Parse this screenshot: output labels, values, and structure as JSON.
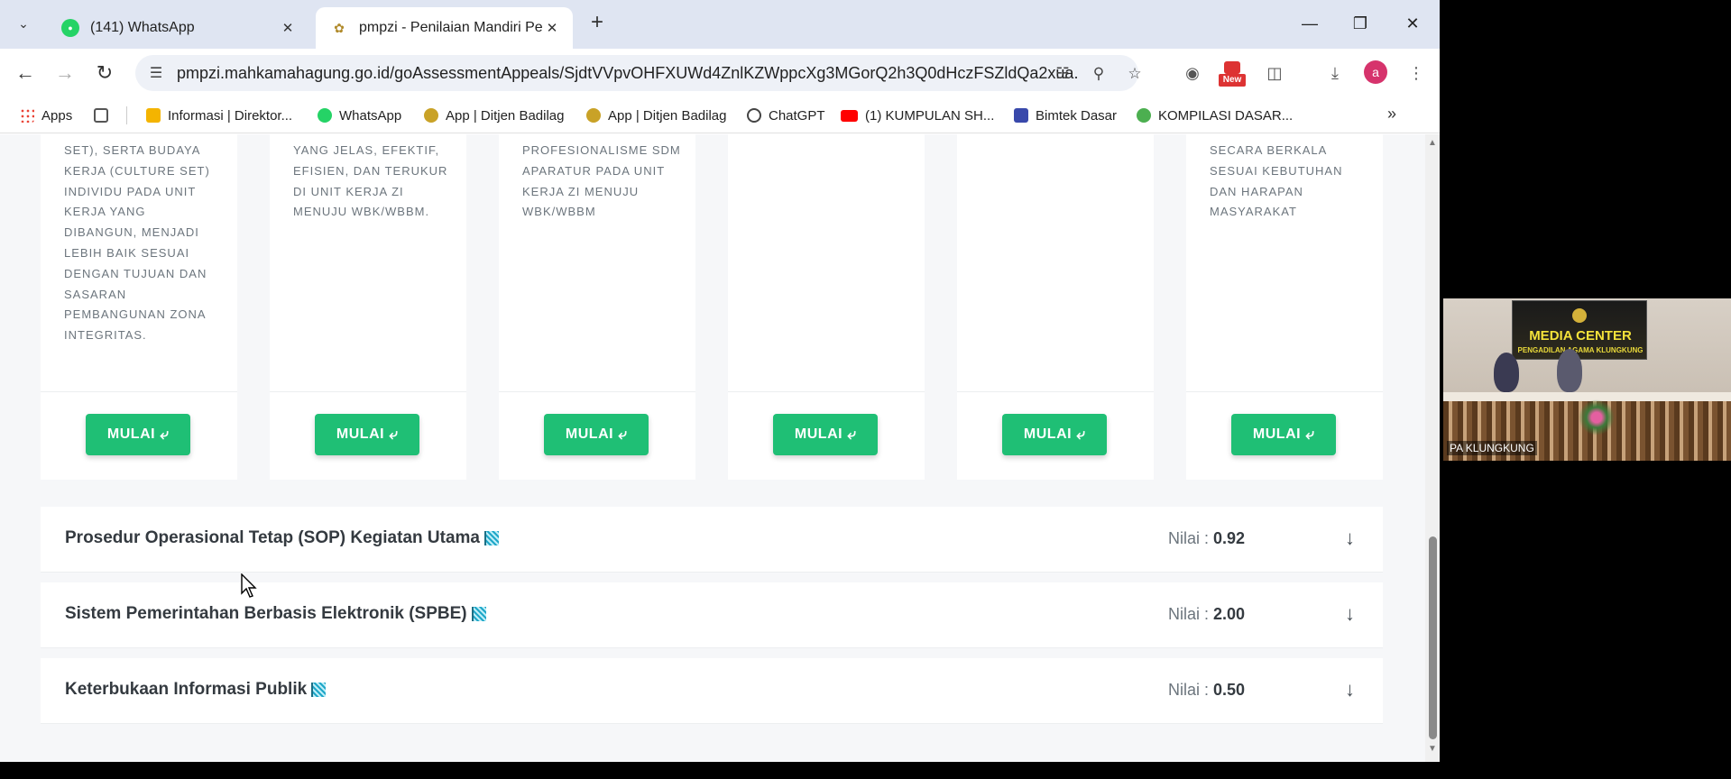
{
  "tabs": [
    {
      "title": "(141) WhatsApp",
      "favicon": "whatsapp-icon",
      "active": false
    },
    {
      "title": "pmpzi - Penilaian Mandiri Pelak",
      "favicon": "pmpzi-logo-icon",
      "active": true
    }
  ],
  "address_bar": {
    "url": "pmpzi.mahkamahagung.go.id/goAssessmentAppeals/SjdtVVpvOHFXUWd4ZnlKZWppcXg3MGorQ2h3Q0dHczFSZldQa2xua..."
  },
  "toolbar": {
    "new_badge": "New",
    "avatar_letter": "a"
  },
  "bookmarks": [
    {
      "label": "Apps",
      "icon": "apps-grid-icon",
      "color": "#4285f4"
    },
    {
      "label": "",
      "icon": "tab-groups-icon",
      "color": "#555555"
    },
    {
      "label": "Informasi | Direktor...",
      "icon": "bookmark-info-icon",
      "color": "#f4b400"
    },
    {
      "label": "WhatsApp",
      "icon": "whatsapp-icon",
      "color": "#25d366"
    },
    {
      "label": "App | Ditjen Badilag",
      "icon": "badilag-icon",
      "color": "#c9a227"
    },
    {
      "label": "App | Ditjen Badilag",
      "icon": "badilag-icon",
      "color": "#c9a227"
    },
    {
      "label": "ChatGPT",
      "icon": "chatgpt-icon",
      "color": "#444444"
    },
    {
      "label": "(1) KUMPULAN SH...",
      "icon": "youtube-icon",
      "color": "#ff0000"
    },
    {
      "label": "Bimtek Dasar",
      "icon": "bimtek-icon",
      "color": "#3949ab"
    },
    {
      "label": "KOMPILASI DASAR...",
      "icon": "kompilasi-icon",
      "color": "#4caf50"
    }
  ],
  "cards": [
    {
      "description": "SET), SERTA BUDAYA KERJA (CULTURE SET) INDIVIDU PADA UNIT KERJA YANG DIBANGUN, MENJADI LEBIH BAIK SESUAI DENGAN TUJUAN DAN SASARAN PEMBANGUNAN ZONA INTEGRITAS.",
      "button": "MULAI"
    },
    {
      "description": "YANG JELAS, EFEKTIF, EFISIEN, DAN TERUKUR DI UNIT KERJA ZI MENUJU WBK/WBBM.",
      "button": "MULAI"
    },
    {
      "description": "PROFESIONALISME SDM APARATUR PADA UNIT KERJA ZI MENUJU WBK/WBBM",
      "button": "MULAI"
    },
    {
      "description": "",
      "button": "MULAI"
    },
    {
      "description": "",
      "button": "MULAI"
    },
    {
      "description": "SECARA BERKALA SESUAI KEBUTUHAN DAN HARAPAN MASYARAKAT",
      "button": "MULAI"
    }
  ],
  "accordion": [
    {
      "title": "Prosedur Operasional Tetap (SOP) Kegiatan Utama",
      "nilai_label": "Nilai :",
      "nilai": "0.92"
    },
    {
      "title": "Sistem Pemerintahan Berbasis Elektronik (SPBE)",
      "nilai_label": "Nilai :",
      "nilai": "2.00"
    },
    {
      "title": "Keterbukaan Informasi Publik",
      "nilai_label": "Nilai :",
      "nilai": "0.50"
    }
  ],
  "video": {
    "banner_title": "MEDIA CENTER",
    "banner_subtitle": "PENGADILAN AGAMA KLUNGKUNG",
    "participant_label": "PA KLUNGKUNG"
  },
  "colors": {
    "accent_green": "#1fbf75",
    "tab_strip": "#dfe5f2",
    "text_dark": "#343a40",
    "text_muted": "#6c757d"
  }
}
